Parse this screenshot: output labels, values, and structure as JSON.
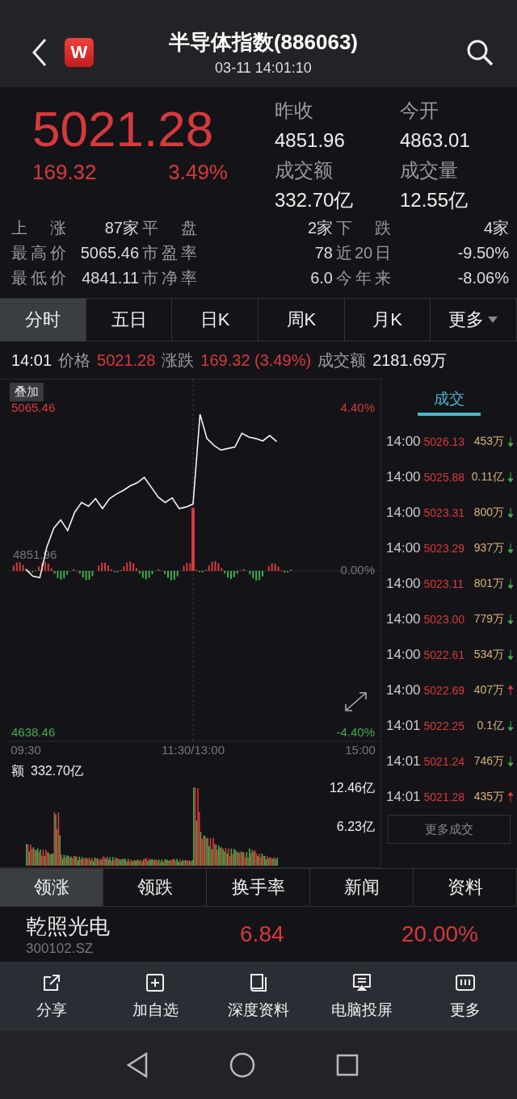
{
  "header": {
    "logo": "W",
    "title": "半导体指数(886063)",
    "subtitle": "03-11 14:01:10"
  },
  "quote": {
    "price": "5021.28",
    "change": "169.32",
    "percent": "3.49%",
    "stats": [
      {
        "label": "昨收",
        "value": "4851.96"
      },
      {
        "label": "今开",
        "value": "4863.01"
      },
      {
        "label": "成交额",
        "value": "332.70亿"
      },
      {
        "label": "成交量",
        "value": "12.55亿"
      }
    ]
  },
  "breadth": [
    [
      {
        "label": "上涨",
        "value": "87家"
      },
      {
        "label": "平盘",
        "value": "2家"
      },
      {
        "label": "下跌",
        "value": "4家"
      }
    ],
    [
      {
        "label": "最高价",
        "value": "5065.46"
      },
      {
        "label": "市盈率",
        "value": "78"
      },
      {
        "label": "近20日",
        "value": "-9.50%"
      }
    ],
    [
      {
        "label": "最低价",
        "value": "4841.11"
      },
      {
        "label": "市净率",
        "value": "6.0"
      },
      {
        "label": "今年来",
        "value": "-8.06%"
      }
    ]
  ],
  "period_tabs": [
    {
      "label": "分时",
      "selected": true
    },
    {
      "label": "五日",
      "selected": false
    },
    {
      "label": "日K",
      "selected": false
    },
    {
      "label": "周K",
      "selected": false
    },
    {
      "label": "月K",
      "selected": false
    },
    {
      "label": "更多",
      "selected": false,
      "dropdown": true
    }
  ],
  "info_line": {
    "time": "14:01",
    "price_label": "价格",
    "price": "5021.28",
    "change_label": "涨跌",
    "change": "169.32 (3.49%)",
    "amount_label": "成交额",
    "amount": "2181.69万"
  },
  "overlay_button": "叠加",
  "price_chart": {
    "high_pct": "4.40%",
    "mid_pct": "0.00%",
    "low_pct": "-4.40%",
    "mid_label": "4851.96",
    "chart_data": {
      "type": "line",
      "categories": [
        null,
        null,
        null,
        null,
        null,
        null,
        null,
        null,
        null,
        null,
        null,
        null,
        null,
        null,
        null,
        null,
        null,
        null,
        null,
        null,
        null,
        null,
        null,
        null,
        null,
        null,
        null,
        null,
        null,
        null,
        null,
        null,
        null,
        null,
        null,
        null,
        null,
        null,
        null,
        null,
        null,
        null,
        null,
        null,
        null,
        null,
        null,
        null,
        null
      ],
      "series": [
        {
          "color": "#f2f2f2",
          "values": [
            4854,
            4845,
            4843,
            4883,
            4908,
            4919,
            4905,
            4929,
            4942,
            4937,
            4947,
            4934,
            4947,
            4953,
            4958,
            4964,
            4968,
            4975,
            4962,
            4949,
            4942,
            4948,
            4934,
            4936,
            4940,
            5058,
            5026,
            5017,
            5011,
            5013,
            5015,
            5033,
            5028,
            5026,
            5023,
            5030,
            5022,
            null,
            null,
            null,
            null,
            null,
            null,
            null,
            null,
            null,
            null,
            null,
            null
          ]
        }
      ],
      "ylim": [
        4638.46,
        5065.46
      ],
      "yticks": [
        {
          "value": 4638.46,
          "label": "4638.46"
        },
        {
          "value": 5065.46,
          "label": "5065.46"
        }
      ]
    },
    "time_axis": [
      "09:30",
      "11:30/13:00",
      "15:00"
    ]
  },
  "volume_chart": {
    "label": "额",
    "total": "332.70亿",
    "high_label": "12.46亿",
    "mid_label": "6.23亿"
  },
  "trades": {
    "tab": "成交",
    "rows": [
      {
        "time": "14:00",
        "price": "5026.13",
        "volume": "453万",
        "rising": false
      },
      {
        "time": "14:00",
        "price": "5025.88",
        "volume": "0.11亿",
        "rising": false
      },
      {
        "time": "14:00",
        "price": "5023.31",
        "volume": "800万",
        "rising": false
      },
      {
        "time": "14:00",
        "price": "5023.29",
        "volume": "937万",
        "rising": false
      },
      {
        "time": "14:00",
        "price": "5023.11",
        "volume": "801万",
        "rising": false
      },
      {
        "time": "14:00",
        "price": "5023.00",
        "volume": "779万",
        "rising": false
      },
      {
        "time": "14:00",
        "price": "5022.61",
        "volume": "534万",
        "rising": false
      },
      {
        "time": "14:00",
        "price": "5022.69",
        "volume": "407万",
        "rising": true
      },
      {
        "time": "14:01",
        "price": "5022.25",
        "volume": "0.1亿",
        "rising": false
      },
      {
        "time": "14:01",
        "price": "5021.24",
        "volume": "746万",
        "rising": false
      },
      {
        "time": "14:01",
        "price": "5021.28",
        "volume": "435万",
        "rising": true
      }
    ],
    "more_button": "更多成交"
  },
  "list_tabs": [
    {
      "label": "领涨",
      "selected": true
    },
    {
      "label": "领跌",
      "selected": false
    },
    {
      "label": "换手率",
      "selected": false
    },
    {
      "label": "新闻",
      "selected": false
    },
    {
      "label": "资料",
      "selected": false
    }
  ],
  "stock_row": {
    "name": "乾照光电",
    "code": "300102.SZ",
    "price": "6.84",
    "percent": "20.00%"
  },
  "toolbar": [
    {
      "kind": "share",
      "label": "分享"
    },
    {
      "kind": "add",
      "label": "加自选"
    },
    {
      "kind": "book",
      "label": "深度资料"
    },
    {
      "kind": "cast",
      "label": "电脑投屏"
    },
    {
      "kind": "more",
      "label": "更多"
    }
  ]
}
